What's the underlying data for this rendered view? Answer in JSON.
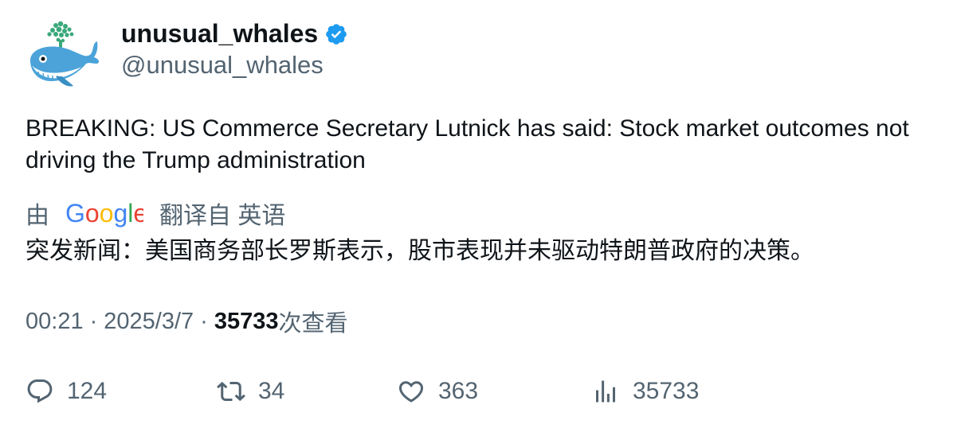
{
  "user": {
    "display_name": "unusual_whales",
    "handle": "@unusual_whales",
    "verified": true,
    "verified_color": "#1d9bf0",
    "avatar_icon": "whale-logo-icon"
  },
  "tweet": {
    "text": "BREAKING: US Commerce Secretary Lutnick has said: Stock market outcomes not driving the Trump administration",
    "translation": {
      "prefix": "由",
      "provider_logo": "Google",
      "suffix": "翻译自 英语",
      "text": "突发新闻：美国商务部长罗斯表示，股市表现并未驱动特朗普政府的决策。"
    },
    "meta": {
      "time": "00:21",
      "separator": "·",
      "date": "2025/3/7",
      "views_count": "35733",
      "views_label": "次查看"
    }
  },
  "actions": {
    "reply": {
      "icon": "reply-icon",
      "count": "124"
    },
    "retweet": {
      "icon": "retweet-icon",
      "count": "34"
    },
    "like": {
      "icon": "heart-icon",
      "count": "363"
    },
    "views": {
      "icon": "analytics-icon",
      "count": "35733"
    }
  },
  "colors": {
    "text_primary": "#0f1419",
    "text_secondary": "#536471",
    "verified_blue": "#1d9bf0"
  }
}
